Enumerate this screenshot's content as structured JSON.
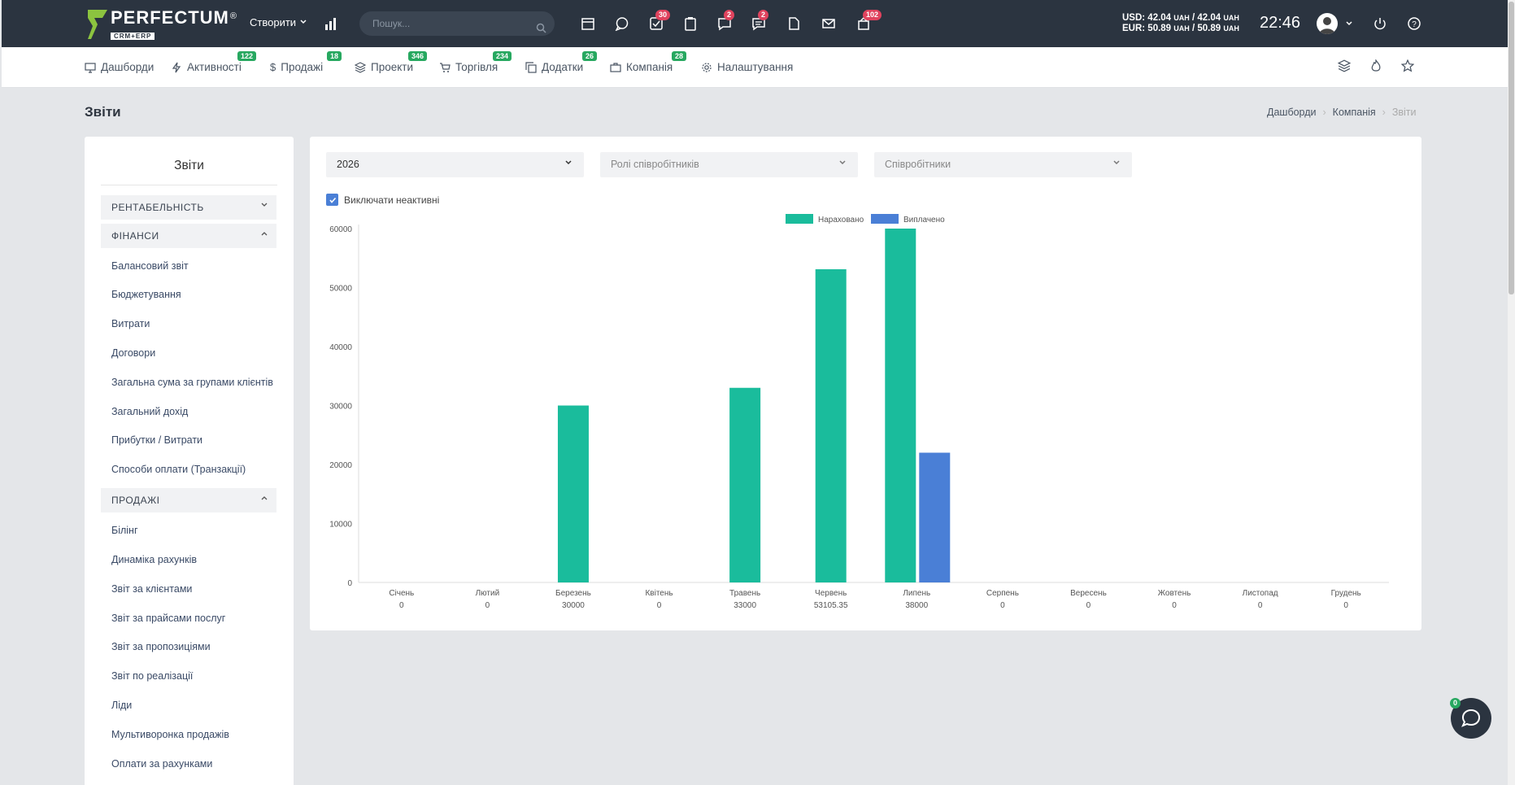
{
  "header": {
    "logo_text": "PERFECTUM",
    "logo_sub": "CRM+ERP",
    "logo_reg": "®",
    "create_label": "Створити",
    "search_placeholder": "Пошук...",
    "badges": {
      "tasks": "30",
      "chat": "2",
      "messages": "2",
      "notifications": "102"
    },
    "rates": {
      "usd": "USD: 42.04",
      "usd_unit": "UAH",
      "usd2": "/ 42.04",
      "eur": "EUR: 50.89",
      "eur_unit": "UAH",
      "eur2": "/ 50.89"
    },
    "time": "22:46"
  },
  "nav": [
    {
      "label": "Дашборди",
      "badge": ""
    },
    {
      "label": "Активності",
      "badge": "122"
    },
    {
      "label": "Продажі",
      "badge": "18"
    },
    {
      "label": "Проекти",
      "badge": "346"
    },
    {
      "label": "Торгівля",
      "badge": "234"
    },
    {
      "label": "Додатки",
      "badge": "26"
    },
    {
      "label": "Компанія",
      "badge": "28"
    },
    {
      "label": "Налаштування",
      "badge": ""
    }
  ],
  "page": {
    "title": "Звіти",
    "breadcrumb": [
      "Дашборди",
      "Компанія",
      "Звіти"
    ]
  },
  "sidebar": {
    "title": "Звіти",
    "sections": [
      {
        "label": "РЕНТАБЕЛЬНІСТЬ",
        "expanded": false,
        "items": []
      },
      {
        "label": "ФІНАНСИ",
        "expanded": true,
        "items": [
          "Балансовий звіт",
          "Бюджетування",
          "Витрати",
          "Договори",
          "Загальна сума за групами клієнтів",
          "Загальний дохід",
          "Прибутки / Витрати",
          "Способи оплати (Транзакції)"
        ]
      },
      {
        "label": "ПРОДАЖІ",
        "expanded": true,
        "items": [
          "Білінг",
          "Динаміка рахунків",
          "Звіт за клієнтами",
          "Звіт за прайсами послуг",
          "Звіт за пропозиціями",
          "Звіт по реалізації",
          "Ліди",
          "Мультиворонка продажів",
          "Оплати за рахунками"
        ]
      }
    ]
  },
  "filters": {
    "year": "2026",
    "roles_placeholder": "Ролі співробітників",
    "staff_placeholder": "Співробітники",
    "exclude_inactive": "Виключати неактивні"
  },
  "chat_badge": "0",
  "chart_data": {
    "type": "bar",
    "categories": [
      "Січень",
      "Лютий",
      "Березень",
      "Квітень",
      "Травень",
      "Червень",
      "Липень",
      "Серпень",
      "Вересень",
      "Жовтень",
      "Листопад",
      "Грудень"
    ],
    "category_totals": [
      "0",
      "0",
      "30000",
      "0",
      "33000",
      "53105.35",
      "38000",
      "0",
      "0",
      "0",
      "0",
      "0"
    ],
    "series": [
      {
        "name": "Нараховано",
        "color": "#1abc9c",
        "values": [
          0,
          0,
          30000,
          0,
          33000,
          53105.35,
          60000,
          0,
          0,
          0,
          0,
          0
        ]
      },
      {
        "name": "Виплачено",
        "color": "#4a7fd6",
        "values": [
          0,
          0,
          0,
          0,
          0,
          0,
          22000,
          0,
          0,
          0,
          0,
          0
        ]
      }
    ],
    "yticks": [
      0,
      10000,
      20000,
      30000,
      40000,
      50000,
      60000
    ],
    "ylim": [
      0,
      60000
    ],
    "legend": "top-center"
  }
}
